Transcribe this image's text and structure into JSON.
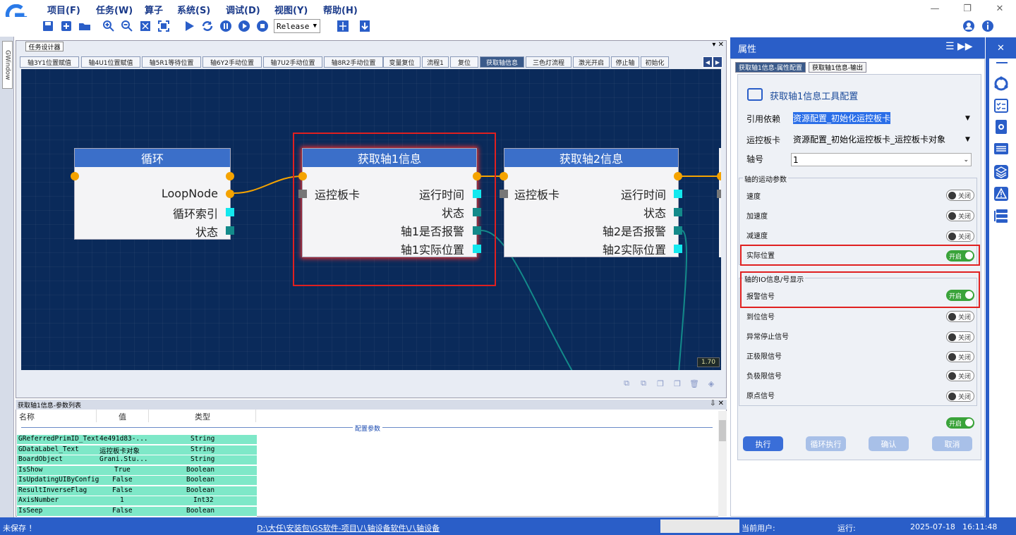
{
  "menu": [
    "项目(F)",
    "任务(W)",
    "算子",
    "系统(S)",
    "调试(D)",
    "视图(Y)",
    "帮助(H)"
  ],
  "window_controls": [
    "—",
    "❐",
    "✕"
  ],
  "toolbar": {
    "config": "Release"
  },
  "left_tab": "GWindow",
  "designer": {
    "tab": "任务设计器",
    "controls": "▾ ✕",
    "flow_tabs": [
      "轴3Y1位置赋值",
      "轴4U1位置赋值",
      "轴5R1等待位置",
      "轴6Y2手动位置",
      "轴7U2手动位置",
      "轴8R2手动位置",
      "变量复位",
      "流程1",
      "复位",
      "获取轴信息",
      "三色灯流程",
      "激光开启",
      "停止轴",
      "初始化"
    ],
    "active_tab": 9,
    "zoom": "1.70"
  },
  "nodes": {
    "loop": {
      "title": "循环",
      "outputs": [
        "LoopNode",
        "循环索引",
        "状态"
      ]
    },
    "axis1": {
      "title": "获取轴1信息",
      "input": "运控板卡",
      "outputs": [
        "运行时间",
        "状态",
        "轴1是否报警",
        "轴1实际位置"
      ]
    },
    "axis2": {
      "title": "获取轴2信息",
      "input": "运控板卡",
      "outputs": [
        "运行时间",
        "状态",
        "轴2是否报警",
        "轴2实际位置"
      ]
    }
  },
  "params": {
    "title": "获取轴1信息-参数列表",
    "controls": "⇩ ✕",
    "headers": [
      "名称",
      "值",
      "类型"
    ],
    "group_label": "配置参数",
    "rows": [
      [
        "GReferredPrimID_Text",
        "4e491d83-...",
        "String"
      ],
      [
        "GDataLabel_Text",
        "运控板卡对象",
        "String"
      ],
      [
        "BoardObject",
        "Grani.Stu...",
        "String"
      ],
      [
        "IsShow",
        "True",
        "Boolean"
      ],
      [
        "IsUpdatingUIByConfig",
        "False",
        "Boolean"
      ],
      [
        "ResultInverseFlag",
        "False",
        "Boolean"
      ],
      [
        "AxisNumber",
        "1",
        "Int32"
      ],
      [
        "IsSeep",
        "False",
        "Boolean"
      ]
    ]
  },
  "properties": {
    "header": "属性",
    "header_icons": "☰ ▶▶",
    "tabs": [
      "获取轴1信息-属性配置",
      "获取轴1信息-输出"
    ],
    "title": "获取轴1信息工具配置",
    "ref_label": "引用依赖",
    "ref_value": "资源配置_初始化运控板卡",
    "board_label": "运控板卡",
    "board_value": "资源配置_初始化运控板卡_运控板卡对象",
    "axis_label": "轴号",
    "axis_value": "1",
    "motion_group": "轴的运动参数",
    "motion_items": [
      {
        "label": "速度",
        "state": "关闭"
      },
      {
        "label": "加速度",
        "state": "关闭"
      },
      {
        "label": "减速度",
        "state": "关闭"
      },
      {
        "label": "实际位置",
        "state": "开启"
      }
    ],
    "io_group": "轴的IO信息/号显示",
    "io_items": [
      {
        "label": "报警信号",
        "state": "开启"
      },
      {
        "label": "到位信号",
        "state": "关闭"
      },
      {
        "label": "异常停止信号",
        "state": "关闭"
      },
      {
        "label": "正极限信号",
        "state": "关闭"
      },
      {
        "label": "负极限信号",
        "state": "关闭"
      },
      {
        "label": "原点信号",
        "state": "关闭"
      }
    ],
    "bottom_toggle": "开启",
    "buttons": [
      "执行",
      "循环执行",
      "确认",
      "取消"
    ]
  },
  "status": {
    "unsaved": "未保存 ！",
    "path": "D:\\大任\\安装包\\GS软件-项目\\八轴设备软件\\八轴设备",
    "user_label": "当前用户:",
    "run_label": "运行:",
    "date": "2025-07-18",
    "time": "16:11:48"
  },
  "colors": {
    "accent": "#2a5ec8",
    "node_header": "#3b6fc9",
    "canvas": "#0a2a5a",
    "highlight": "#e02020",
    "toggle_on": "#3aa33a"
  }
}
